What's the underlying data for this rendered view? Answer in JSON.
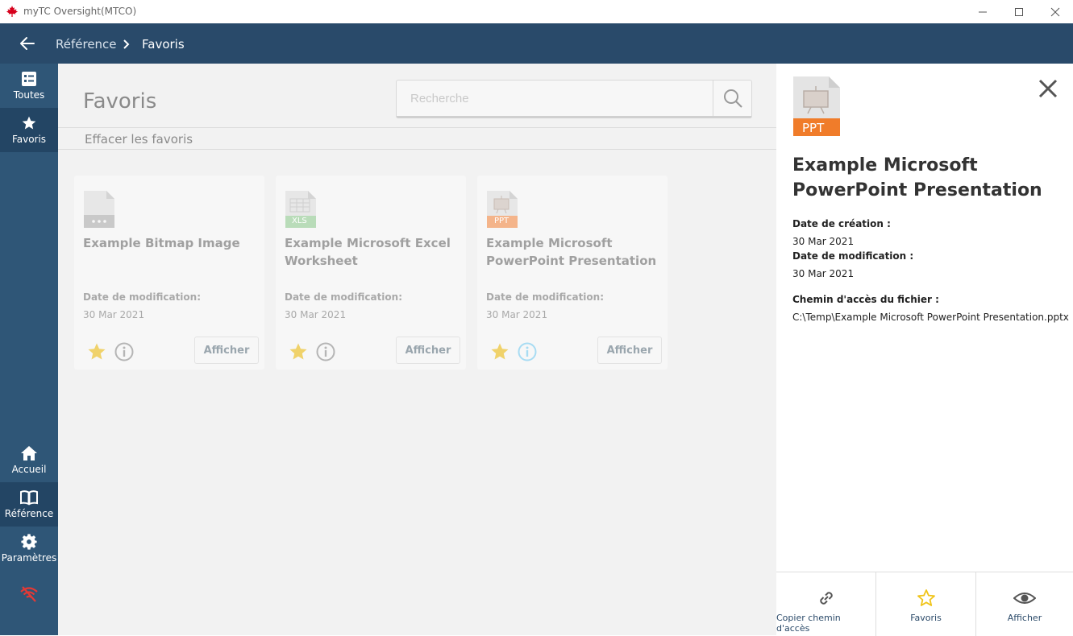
{
  "window": {
    "title": "myTC Oversight(MTCO)"
  },
  "breadcrumb": {
    "parent": "Référence",
    "current": "Favoris"
  },
  "sidebar": {
    "top_items": [
      {
        "label": "Toutes",
        "icon": "list-icon"
      },
      {
        "label": "Favoris",
        "icon": "star-icon"
      }
    ],
    "bottom_items": [
      {
        "label": "Accueil",
        "icon": "home-icon"
      },
      {
        "label": "Référence",
        "icon": "book-icon"
      },
      {
        "label": "Paramètres",
        "icon": "gear-icon"
      }
    ],
    "status_icon": "wifi-off-icon"
  },
  "main": {
    "title": "Favoris",
    "search_placeholder": "Recherche",
    "clear_label": "Effacer les favoris",
    "cards": [
      {
        "name": "Example Bitmap Image",
        "type": "bmp",
        "date_label": "Date de modification:",
        "date": "30 Mar 2021",
        "view_label": "Afficher"
      },
      {
        "name": "Example Microsoft Excel Worksheet",
        "type": "XLS",
        "date_label": "Date de modification:",
        "date": "30 Mar 2021",
        "view_label": "Afficher"
      },
      {
        "name": "Example Microsoft PowerPoint Presentation",
        "type": "PPT",
        "date_label": "Date de modification:",
        "date": "30 Mar 2021",
        "view_label": "Afficher"
      }
    ]
  },
  "details": {
    "file_type": "PPT",
    "title": "Example Microsoft PowerPoint Presentation",
    "created_label": "Date de création :",
    "created": "30 Mar 2021",
    "modified_label": "Date de modification :",
    "modified": "30 Mar 2021",
    "path_label": "Chemin d'accès du fichier :",
    "path": "C:\\Temp\\Example Microsoft PowerPoint Presentation.pptx",
    "actions": [
      {
        "label": "Copier chemin d'accès",
        "icon": "link-icon"
      },
      {
        "label": "Favoris",
        "icon": "star-outline-icon"
      },
      {
        "label": "Afficher",
        "icon": "eye-icon"
      }
    ]
  },
  "colors": {
    "navbar": "#294a6a",
    "sidebar": "#2f5677",
    "sidebar_active": "#234564",
    "star": "#f0c419",
    "ppt": "#f07c2a",
    "xls": "#4caf50",
    "wifi_off": "#e53935"
  }
}
